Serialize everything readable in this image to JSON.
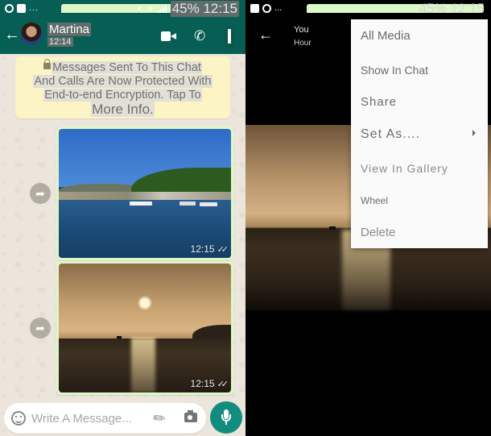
{
  "left": {
    "status_bar": {
      "battery": "45%",
      "time": "12:15",
      "overflow": "..."
    },
    "header": {
      "contact_name": "Martina",
      "last_seen": "12:14"
    },
    "encryption_notice": {
      "lines": [
        "Messages Sent To This Chat",
        "And Calls Are Now Protected With",
        "End-to-end Encryption. Tap To"
      ],
      "more": "More Info."
    },
    "messages": [
      {
        "type": "image",
        "subject": "harbor",
        "time": "12:15",
        "status": "read"
      },
      {
        "type": "image",
        "subject": "sunset",
        "time": "12:15",
        "status": "read"
      }
    ],
    "composer": {
      "placeholder": "Write A Message..."
    },
    "icons": {
      "back": "←",
      "phone": "📞",
      "forward": "➦",
      "ticks": "✓✓",
      "clip": "📎"
    }
  },
  "right": {
    "status_bar": {
      "battery": "45%",
      "time": "12:15",
      "overflow": "..."
    },
    "header": {
      "title": "You",
      "subtitle": "Hour"
    },
    "menu": {
      "items": [
        "All Media",
        "Show In Chat",
        "Share",
        "Set As....",
        "View In Gallery",
        "Wheel",
        "Delete"
      ]
    }
  },
  "colors": {
    "whatsapp_header": "#075e54",
    "bubble_outgoing": "#dcf8c6",
    "encryption_notice": "#fcf4c4",
    "mic_button": "#128c7e"
  }
}
